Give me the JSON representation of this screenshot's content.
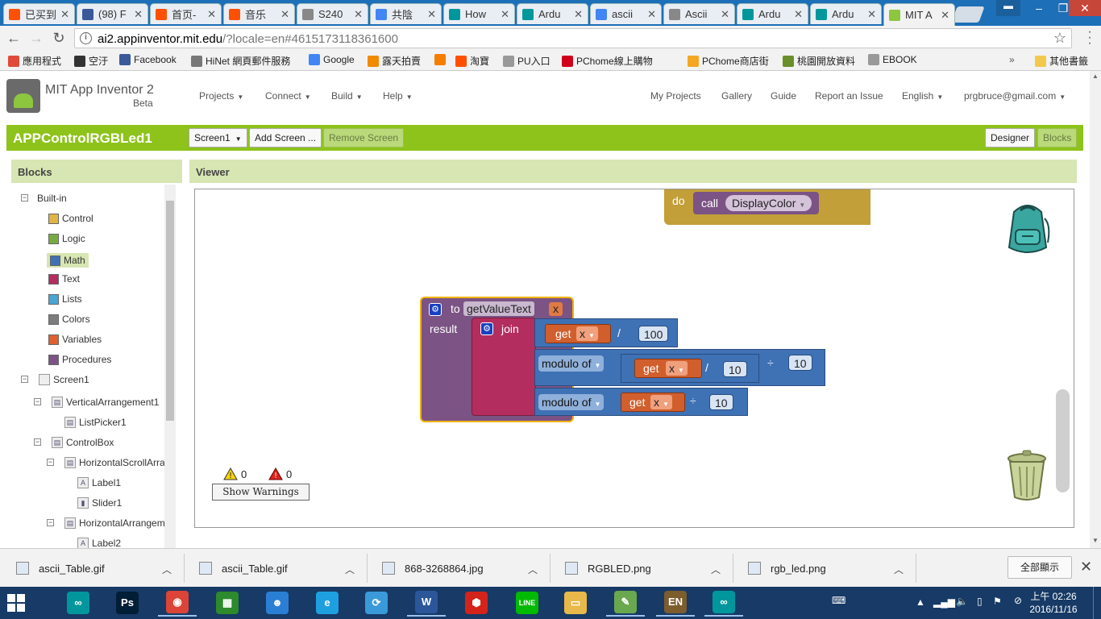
{
  "browser": {
    "tabs": [
      {
        "title": "已买到",
        "icon": "taobao-icon",
        "color": "#ff5000"
      },
      {
        "title": "(98) F",
        "icon": "facebook-icon",
        "color": "#3b5998"
      },
      {
        "title": "首页-",
        "icon": "taobao-icon",
        "color": "#ff5000"
      },
      {
        "title": "音乐",
        "icon": "taobao-icon",
        "color": "#ff5000"
      },
      {
        "title": "S240",
        "icon": "document-icon",
        "color": "#888888"
      },
      {
        "title": "共陰",
        "icon": "google-icon",
        "color": "#4285f4"
      },
      {
        "title": "How",
        "icon": "arduino-icon",
        "color": "#00979c"
      },
      {
        "title": "Ardu",
        "icon": "arduino-icon",
        "color": "#00979c"
      },
      {
        "title": "ascii",
        "icon": "google-icon",
        "color": "#4285f4"
      },
      {
        "title": "Ascii",
        "icon": "document-icon",
        "color": "#888888"
      },
      {
        "title": "Ardu",
        "icon": "arduino-icon",
        "color": "#00979c"
      },
      {
        "title": "Ardu",
        "icon": "arduino-icon",
        "color": "#00979c"
      },
      {
        "title": "MIT A",
        "icon": "app-inventor-icon",
        "color": "#8dc63f",
        "active": true
      }
    ],
    "url_host": "ai2.appinventor.mit.edu",
    "url_rest": "/?locale=en#4615173118361600",
    "bookmarks": [
      {
        "label": "應用程式",
        "icon": "apps-grid-icon",
        "color": "#e04a3a"
      },
      {
        "label": "空汙",
        "icon": "no-icon",
        "color": "#333333"
      },
      {
        "label": "Facebook",
        "icon": "facebook-icon",
        "color": "#3b5998"
      },
      {
        "label": "HiNet 網頁郵件服務",
        "icon": "mail-icon",
        "color": "#777777"
      },
      {
        "label": "Google",
        "icon": "google-icon",
        "color": "#4285f4"
      },
      {
        "label": "露天拍賣",
        "icon": "ruten-icon",
        "color": "#f08a00"
      },
      {
        "label": "",
        "icon": "blogger-icon",
        "color": "#f57d00"
      },
      {
        "label": "淘寶",
        "icon": "taobao-icon",
        "color": "#ff5000"
      },
      {
        "label": "PU入口",
        "icon": "page-icon",
        "color": "#999999"
      },
      {
        "label": "PChome線上購物",
        "icon": "pchome-icon",
        "color": "#d0021b"
      },
      {
        "label": "PChome商店街",
        "icon": "pchome-store-icon",
        "color": "#f5a623"
      },
      {
        "label": "桃園開放資料",
        "icon": "taoyuan-icon",
        "color": "#6a8f2a"
      },
      {
        "label": "EBOOK",
        "icon": "page-icon",
        "color": "#999999"
      }
    ],
    "overflow": "»",
    "other_bookmarks": "其他書籤"
  },
  "app": {
    "name": "MIT App Inventor 2",
    "beta": "Beta",
    "menus": [
      "Projects",
      "Connect",
      "Build",
      "Help"
    ],
    "right_links": [
      "My Projects",
      "Gallery",
      "Guide",
      "Report an Issue"
    ],
    "language": "English",
    "user": "prgbruce@gmail.com",
    "project": "APPControlRGBLed1",
    "screen_select": "Screen1",
    "add_screen": "Add Screen ...",
    "remove_screen": "Remove Screen",
    "designer": "Designer",
    "blocks_btn": "Blocks",
    "blocks_panel_title": "Blocks",
    "viewer_title": "Viewer",
    "accent": "#8dc31a"
  },
  "tree": {
    "builtin": "Built-in",
    "categories": [
      {
        "label": "Control",
        "color": "#e0b445"
      },
      {
        "label": "Logic",
        "color": "#77ab41"
      },
      {
        "label": "Math",
        "color": "#3f71b5",
        "selected": true
      },
      {
        "label": "Text",
        "color": "#b32d5e"
      },
      {
        "label": "Lists",
        "color": "#49a6d4"
      },
      {
        "label": "Colors",
        "color": "#7d7d7d"
      },
      {
        "label": "Variables",
        "color": "#e0602e"
      },
      {
        "label": "Procedures",
        "color": "#7c5385"
      }
    ],
    "screen": "Screen1",
    "components": [
      {
        "label": "VerticalArrangement1",
        "depth": 1
      },
      {
        "label": "ListPicker1",
        "depth": 2
      },
      {
        "label": "ControlBox",
        "depth": 1
      },
      {
        "label": "HorizontalScrollArra",
        "depth": 2
      },
      {
        "label": "Label1",
        "depth": 3
      },
      {
        "label": "Slider1",
        "depth": 3
      },
      {
        "label": "HorizontalArrangem",
        "depth": 2
      },
      {
        "label": "Label2",
        "depth": 3
      }
    ]
  },
  "blocks": {
    "do_label": "do",
    "call_label": "call",
    "display_color": "DisplayColor",
    "to_label": "to",
    "proc_name": "getValueText",
    "param": "x",
    "result_label": "result",
    "join_label": "join",
    "get_label": "get",
    "get_var": "x",
    "divide": "/",
    "num_100": "100",
    "modulo_label": "modulo of",
    "num_10a": "10",
    "quotient": "÷",
    "num_10b": "10",
    "num_10c": "10",
    "colors": {
      "control": "#c29f39",
      "procedure": "#7c5385",
      "text": "#b32d5e",
      "math": "#3f71b5",
      "variable": "#d05f2d"
    }
  },
  "warnings": {
    "warn_count": "0",
    "error_count": "0",
    "button": "Show Warnings"
  },
  "downloads": {
    "items": [
      "ascii_Table.gif",
      "ascii_Table.gif",
      "868-3268864.jpg",
      "RGBLED.png",
      "rgb_led.png"
    ],
    "show_all": "全部顯示"
  },
  "taskbar": {
    "apps": [
      {
        "name": "arduino-icon",
        "label": "∞",
        "color": "#00979c"
      },
      {
        "name": "photoshop-icon",
        "label": "Ps",
        "color": "#001e36"
      },
      {
        "name": "chrome-icon",
        "label": "◉",
        "color": "#db4437",
        "open": true
      },
      {
        "name": "store-icon",
        "label": "▦",
        "color": "#2d8a2d"
      },
      {
        "name": "droplet-icon",
        "label": "☻",
        "color": "#2a7fd4"
      },
      {
        "name": "ie-icon",
        "label": "e",
        "color": "#1ea0e0"
      },
      {
        "name": "network-icon",
        "label": "⟳",
        "color": "#3a9ad9"
      },
      {
        "name": "word-icon",
        "label": "W",
        "color": "#2b579a",
        "open": true
      },
      {
        "name": "acrobat-icon",
        "label": "⬢",
        "color": "#d4231a"
      },
      {
        "name": "line-icon",
        "label": "LINE",
        "color": "#00b900"
      },
      {
        "name": "explorer-icon",
        "label": "▭",
        "color": "#e8b94a"
      },
      {
        "name": "notepad-icon",
        "label": "✎",
        "color": "#6aa84f",
        "open": true
      },
      {
        "name": "ime-icon",
        "label": "EN",
        "color": "#7d5c2d",
        "open": true
      },
      {
        "name": "arduino2-icon",
        "label": "∞",
        "color": "#00979c",
        "open": true
      }
    ],
    "time": "上午 02:26",
    "date": "2016/11/16"
  }
}
